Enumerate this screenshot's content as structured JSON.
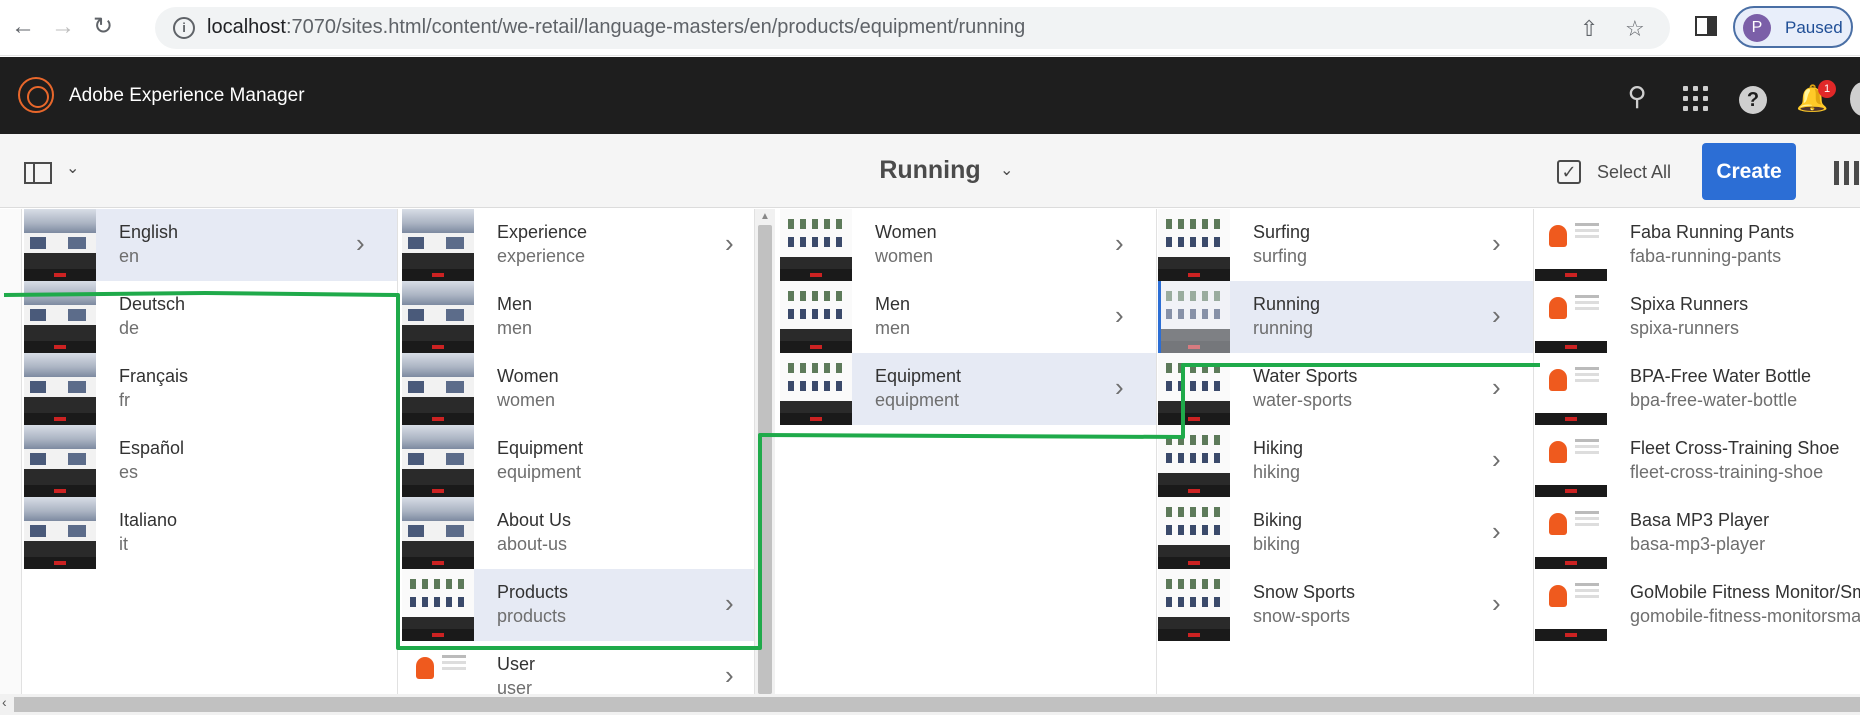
{
  "browser": {
    "url_host": "localhost",
    "url_path": ":7070/sites.html/content/we-retail/language-masters/en/products/equipment/running",
    "profile_initial": "P",
    "profile_status": "Paused"
  },
  "header": {
    "title": "Adobe Experience Manager",
    "notification_count": "1"
  },
  "actionbar": {
    "page_title": "Running",
    "select_all": "Select All",
    "create": "Create"
  },
  "columns": [
    {
      "items": [
        {
          "title": "English",
          "name": "en",
          "state": "active",
          "chevron": true
        },
        {
          "title": "Deutsch",
          "name": "de"
        },
        {
          "title": "Français",
          "name": "fr"
        },
        {
          "title": "Español",
          "name": "es"
        },
        {
          "title": "Italiano",
          "name": "it"
        }
      ]
    },
    {
      "items": [
        {
          "title": "Experience",
          "name": "experience",
          "chevron": true
        },
        {
          "title": "Men",
          "name": "men"
        },
        {
          "title": "Women",
          "name": "women"
        },
        {
          "title": "Equipment",
          "name": "equipment"
        },
        {
          "title": "About Us",
          "name": "about-us"
        },
        {
          "title": "Products",
          "name": "products",
          "state": "active",
          "chevron": true
        },
        {
          "title": "User",
          "name": "user",
          "chevron": true
        }
      ]
    },
    {
      "items": [
        {
          "title": "Women",
          "name": "women",
          "chevron": true
        },
        {
          "title": "Men",
          "name": "men",
          "chevron": true
        },
        {
          "title": "Equipment",
          "name": "equipment",
          "state": "active",
          "chevron": true
        }
      ]
    },
    {
      "items": [
        {
          "title": "Surfing",
          "name": "surfing",
          "chevron": true
        },
        {
          "title": "Running",
          "name": "running",
          "state": "selected",
          "chevron": true
        },
        {
          "title": "Water Sports",
          "name": "water-sports",
          "chevron": true
        },
        {
          "title": "Hiking",
          "name": "hiking",
          "chevron": true
        },
        {
          "title": "Biking",
          "name": "biking",
          "chevron": true
        },
        {
          "title": "Snow Sports",
          "name": "snow-sports",
          "chevron": true
        }
      ]
    },
    {
      "items": [
        {
          "title": "Faba Running Pants",
          "name": "faba-running-pants"
        },
        {
          "title": "Spixa Runners",
          "name": "spixa-runners"
        },
        {
          "title": "BPA-Free Water Bottle",
          "name": "bpa-free-water-bottle"
        },
        {
          "title": "Fleet Cross-Training Shoe",
          "name": "fleet-cross-training-shoe"
        },
        {
          "title": "Basa MP3 Player",
          "name": "basa-mp3-player"
        },
        {
          "title": "GoMobile Fitness Monitor/Sm",
          "name": "gomobile-fitness-monitorsma"
        }
      ]
    }
  ],
  "icons": [
    "back-icon",
    "forward-icon",
    "reload-icon",
    "site-info-icon",
    "share-icon",
    "bookmark-star-icon",
    "side-panel-icon",
    "aem-logo-icon",
    "search-icon",
    "apps-grid-icon",
    "help-icon",
    "notifications-bell-icon",
    "rail-toggle-icon",
    "chevron-down-icon",
    "select-all-checkbox-icon",
    "column-view-icon",
    "chevron-right-icon"
  ],
  "colors": {
    "accent": "#2c6ed5",
    "header_bg": "#1e1e1e",
    "annotation": "#1faa4a",
    "badge": "#e02828"
  }
}
